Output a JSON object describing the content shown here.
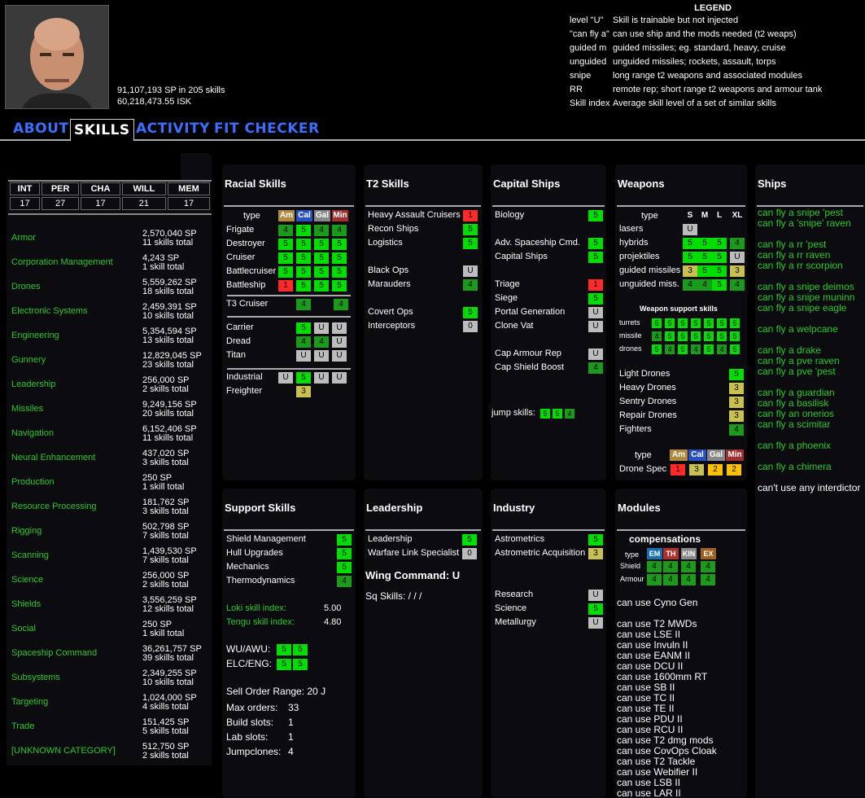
{
  "character": {
    "sp_line": "91,107,193 SP in 205 skills",
    "isk": "60,218,473.55 ISK"
  },
  "legend": {
    "title": "LEGEND",
    "rows": [
      {
        "key": "level \"U\"",
        "desc": "Skill is trainable but not injected"
      },
      {
        "key": "\"can fly a\"",
        "desc": "can use ship and the mods needed (t2 weaps)"
      },
      {
        "key": "guided m",
        "desc": "guided missiles; eg. standard, heavy, cruise"
      },
      {
        "key": "unguided",
        "desc": "unguided missiles; rockets, assault, torps"
      },
      {
        "key": "snipe",
        "desc": "long range t2 weapons and associated modules"
      },
      {
        "key": "RR",
        "desc": "remote rep; short range t2 weapons and armour tank"
      },
      {
        "key": "Skill index",
        "desc": "Average skill level of a set of similar skills"
      }
    ]
  },
  "tabs": [
    "ABOUT",
    "SKILLS",
    "ACTIVITY",
    "FIT CHECKER"
  ],
  "attributes": {
    "headers": [
      "INT",
      "PER",
      "CHA",
      "WILL",
      "MEM"
    ],
    "values": [
      "17",
      "27",
      "17",
      "21",
      "17"
    ]
  },
  "categories": [
    {
      "name": "Armor",
      "sp": "2,570,040 SP",
      "skills": "11 skills total"
    },
    {
      "name": "Corporation Management",
      "sp": "4,243 SP",
      "skills": "1 skill total"
    },
    {
      "name": "Drones",
      "sp": "5,559,262 SP",
      "skills": "18 skills total"
    },
    {
      "name": "Electronic Systems",
      "sp": "2,459,391 SP",
      "skills": "10 skills total"
    },
    {
      "name": "Engineering",
      "sp": "5,354,594 SP",
      "skills": "13 skills total"
    },
    {
      "name": "Gunnery",
      "sp": "12,829,045 SP",
      "skills": "23 skills total"
    },
    {
      "name": "Leadership",
      "sp": "256,000 SP",
      "skills": "2 skills total"
    },
    {
      "name": "Missiles",
      "sp": "9,249,156 SP",
      "skills": "20 skills total"
    },
    {
      "name": "Navigation",
      "sp": "6,152,406 SP",
      "skills": "11 skills total"
    },
    {
      "name": "Neural Enhancement",
      "sp": "437,020 SP",
      "skills": "3 skills total"
    },
    {
      "name": "Production",
      "sp": "250 SP",
      "skills": "1 skill total"
    },
    {
      "name": "Resource Processing",
      "sp": "181,762 SP",
      "skills": "3 skills total"
    },
    {
      "name": "Rigging",
      "sp": "502,798 SP",
      "skills": "7 skills total"
    },
    {
      "name": "Scanning",
      "sp": "1,439,530 SP",
      "skills": "7 skills total"
    },
    {
      "name": "Science",
      "sp": "256,000 SP",
      "skills": "2 skills total"
    },
    {
      "name": "Shields",
      "sp": "3,556,259 SP",
      "skills": "12 skills total"
    },
    {
      "name": "Social",
      "sp": "250 SP",
      "skills": "1 skill total"
    },
    {
      "name": "Spaceship Command",
      "sp": "36,261,757 SP",
      "skills": "39 skills total"
    },
    {
      "name": "Subsystems",
      "sp": "2,349,255 SP",
      "skills": "10 skills total"
    },
    {
      "name": "Targeting",
      "sp": "1,024,000 SP",
      "skills": "4 skills total"
    },
    {
      "name": "Trade",
      "sp": "151,425 SP",
      "skills": "5 skills total"
    },
    {
      "name": "[UNKNOWN CATEGORY]",
      "sp": "512,750 SP",
      "skills": "2 skills total"
    }
  ],
  "racial": {
    "title": "Racial Skills",
    "type_label": "type",
    "races": [
      "Am",
      "Cal",
      "Gal",
      "Min"
    ],
    "rows": [
      {
        "name": "Frigate",
        "levels": [
          "4",
          "5",
          "4",
          "4"
        ]
      },
      {
        "name": "Destroyer",
        "levels": [
          "5",
          "5",
          "5",
          "5"
        ]
      },
      {
        "name": "Cruiser",
        "levels": [
          "5",
          "5",
          "5",
          "5"
        ]
      },
      {
        "name": "Battlecruiser",
        "levels": [
          "5",
          "5",
          "5",
          "5"
        ]
      },
      {
        "name": "Battleship",
        "levels": [
          "1",
          "5",
          "5",
          "5"
        ]
      }
    ],
    "t3": {
      "name": "T3 Cruiser",
      "levels": [
        "4",
        "",
        "4"
      ]
    },
    "caps": [
      {
        "name": "Carrier",
        "levels": [
          "5",
          "U",
          "U"
        ]
      },
      {
        "name": "Dread",
        "levels": [
          "4",
          "4",
          "U"
        ]
      },
      {
        "name": "Titan",
        "levels": [
          "U",
          "U",
          "U"
        ]
      }
    ],
    "industrial": {
      "name": "Industrial",
      "levels": [
        "U",
        "5",
        "U",
        "U"
      ]
    },
    "freighter": {
      "name": "Freighter",
      "levels": [
        "3"
      ]
    }
  },
  "t2": {
    "title": "T2 Skills",
    "rows": [
      {
        "name": "Heavy Assault Cruisers",
        "level": "1"
      },
      {
        "name": "Recon Ships",
        "level": "5"
      },
      {
        "name": "Logistics",
        "level": "5"
      },
      {
        "name": "Black Ops",
        "level": "U"
      },
      {
        "name": "Marauders",
        "level": "4"
      },
      {
        "name": "Covert Ops",
        "level": "5"
      },
      {
        "name": "Interceptors",
        "level": "0"
      }
    ]
  },
  "capital": {
    "title": "Capital Ships",
    "rows": [
      {
        "name": "Biology",
        "level": "5"
      },
      {
        "name": "Adv. Spaceship Cmd.",
        "level": "5"
      },
      {
        "name": "Capital Ships",
        "level": "5"
      },
      {
        "name": "Triage",
        "level": "1"
      },
      {
        "name": "Siege",
        "level": "5"
      },
      {
        "name": "Portal Generation",
        "level": "U"
      },
      {
        "name": "Clone Vat",
        "level": "U"
      },
      {
        "name": "Cap Armour Rep",
        "level": "U"
      },
      {
        "name": "Cap Shield Boost",
        "level": "4"
      }
    ],
    "jump_label": "jump skills:",
    "jump": [
      "5",
      "5",
      "4"
    ]
  },
  "weapons": {
    "title": "Weapons",
    "type_label": "type",
    "sizes": [
      "S",
      "M",
      "L",
      "XL"
    ],
    "rows": [
      {
        "name": "lasers",
        "levels": [
          "U",
          "",
          "",
          ""
        ]
      },
      {
        "name": "hybrids",
        "levels": [
          "5",
          "5",
          "5",
          "4"
        ]
      },
      {
        "name": "projektiles",
        "levels": [
          "5",
          "5",
          "5",
          "U"
        ]
      },
      {
        "name": "guided missiles",
        "levels": [
          "3",
          "5",
          "5",
          "3"
        ]
      },
      {
        "name": "unguided miss.",
        "levels": [
          "4",
          "4",
          "5",
          "4"
        ]
      }
    ],
    "support_title": "Weapon support skills",
    "support": [
      {
        "name": "turrets",
        "levels": [
          "5",
          "5",
          "5",
          "5",
          "5",
          "5",
          "5"
        ]
      },
      {
        "name": "missile",
        "levels": [
          "4",
          "5",
          "5",
          "5",
          "5",
          "5",
          "5"
        ]
      },
      {
        "name": "drones",
        "levels": [
          "5",
          "4",
          "5",
          "4",
          "5",
          "4",
          "5"
        ]
      }
    ],
    "drones": [
      {
        "name": "Light Drones",
        "level": "5"
      },
      {
        "name": "Heavy Drones",
        "level": "3"
      },
      {
        "name": "Sentry Drones",
        "level": "3"
      },
      {
        "name": "Repair Drones",
        "level": "3"
      },
      {
        "name": "Fighters",
        "level": "4"
      }
    ],
    "drone_spec": {
      "type_label": "type",
      "races": [
        "Am",
        "Cal",
        "Gal",
        "Min"
      ],
      "name": "Drone Spec",
      "levels": [
        "1",
        "3",
        "2",
        "2"
      ]
    }
  },
  "ships": {
    "title": "Ships",
    "items": [
      "can fly a snipe 'pest",
      "can fly a 'snipe' raven",
      "can fly a rr 'pest",
      "can fly a rr raven",
      "can fly a rr scorpion",
      "can fly a snipe deimos",
      "can fly a snipe muninn",
      "can fly a snipe eagle",
      "can fly a welpcane",
      "can fly a drake",
      "can fly a pve raven",
      "can fly a pve 'pest",
      "can fly a guardian",
      "can fly a basilisk",
      "can fly an onerios",
      "can fly a scimitar",
      "can fly a phoenix",
      "can fly a chimera"
    ],
    "interdictor": "can't use any interdictor"
  },
  "support": {
    "title": "Support Skills",
    "rows": [
      {
        "name": "Shield Management",
        "level": "5"
      },
      {
        "name": "Hull Upgrades",
        "level": "5"
      },
      {
        "name": "Mechanics",
        "level": "5"
      },
      {
        "name": "Thermodynamics",
        "level": "4"
      }
    ],
    "loki_label": "Loki skill index:",
    "loki": "5.00",
    "tengu_label": "Tengu skill index:",
    "tengu": "4.80",
    "wu_label": "WU/AWU:",
    "wu": [
      "5",
      "5"
    ],
    "elc_label": "ELC/ENG:",
    "elc": [
      "5",
      "5"
    ],
    "sell": "Sell Order Range:  20 J",
    "max_orders_label": "Max orders:",
    "max_orders": "33",
    "build_label": "Build slots:",
    "build": "1",
    "lab_label": "Lab slots:",
    "lab": "1",
    "jc_label": "Jumpclones:",
    "jc": "4"
  },
  "leadership": {
    "title": "Leadership",
    "rows": [
      {
        "name": "Leadership",
        "level": "5"
      },
      {
        "name": "Warfare Link Specialist",
        "level": "0"
      }
    ],
    "wing": "Wing Command: U",
    "sq": "Sq Skills:    /   /   /"
  },
  "industry": {
    "title": "Industry",
    "rows": [
      {
        "name": "Astrometrics",
        "level": "5"
      },
      {
        "name": "Astrometric Acquisition",
        "level": "3"
      },
      {
        "name": "Research",
        "level": "U"
      },
      {
        "name": "Science",
        "level": "5"
      },
      {
        "name": "Metallurgy",
        "level": "U"
      }
    ]
  },
  "modules": {
    "title": "Modules",
    "comp_title": "compensations",
    "type_label": "type",
    "comp_headers": [
      "EM",
      "TH",
      "KIN",
      "EX"
    ],
    "comp_rows": [
      {
        "name": "Shield",
        "levels": [
          "4",
          "4",
          "4",
          "4"
        ]
      },
      {
        "name": "Armour",
        "levels": [
          "4",
          "4",
          "4",
          "4"
        ]
      }
    ],
    "cyno": "can use Cyno Gen",
    "items": [
      "can use T2 MWDs",
      "can use LSE II",
      "can use Invuln II",
      "can use EANM II",
      "can use DCU II",
      "can use 1600mm RT",
      "can use SB II",
      "can use TC II",
      "can use TE II",
      "can use PDU II",
      "can use RCU II",
      "can use T2 dmg mods",
      "can use CovOps Cloak",
      "can use T2 Tackle",
      "can use Webifier II",
      "can use LSB II",
      "can use LAR II"
    ]
  },
  "colors": {
    "level5": "#00dd00",
    "level4": "#1c9a1c",
    "level_low": "#ff2a2a",
    "untrained": "#bcbcbc",
    "level3": "#c8c050",
    "tab": "#3b6fff",
    "category": "#29c929"
  }
}
